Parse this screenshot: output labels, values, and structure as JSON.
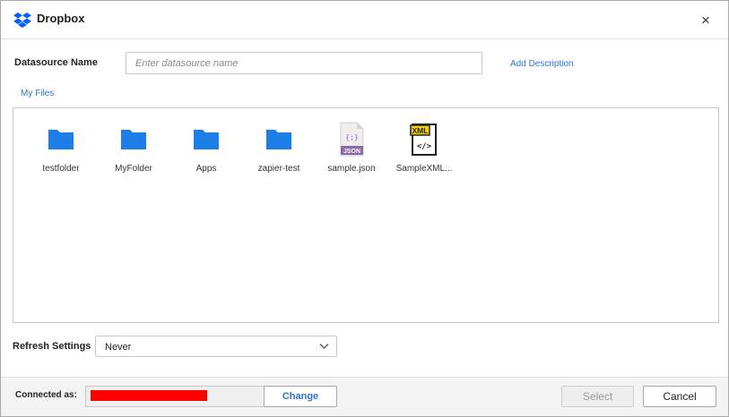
{
  "dialog": {
    "title": "Dropbox",
    "close_label": "×"
  },
  "datasource": {
    "label": "Datasource Name",
    "value": "",
    "placeholder": "Enter datasource name",
    "add_description": "Add Description"
  },
  "breadcrumb": {
    "path": "My Files"
  },
  "files": [
    {
      "name": "testfolder",
      "icon": "folder-icon"
    },
    {
      "name": "MyFolder",
      "icon": "folder-icon"
    },
    {
      "name": "Apps",
      "icon": "folder-icon"
    },
    {
      "name": "zapier-test",
      "icon": "folder-icon"
    },
    {
      "name": "sample.json",
      "icon": "json-file-icon",
      "badge": "JSON",
      "glyph": "{;}"
    },
    {
      "name": "SampleXML...",
      "icon": "xml-file-icon",
      "badge": "XML",
      "glyph": "</>"
    }
  ],
  "refresh": {
    "label": "Refresh Settings",
    "selected": "Never"
  },
  "footer": {
    "connected_label": "Connected as:",
    "change_label": "Change",
    "select_label": "Select",
    "cancel_label": "Cancel"
  },
  "colors": {
    "accent": "#2e73c9",
    "folder": "#1e7ee8",
    "dropbox": "#0061fe",
    "json_badge": "#8b6aa8",
    "xml_badge": "#f5d000",
    "redaction": "#ff0000"
  }
}
